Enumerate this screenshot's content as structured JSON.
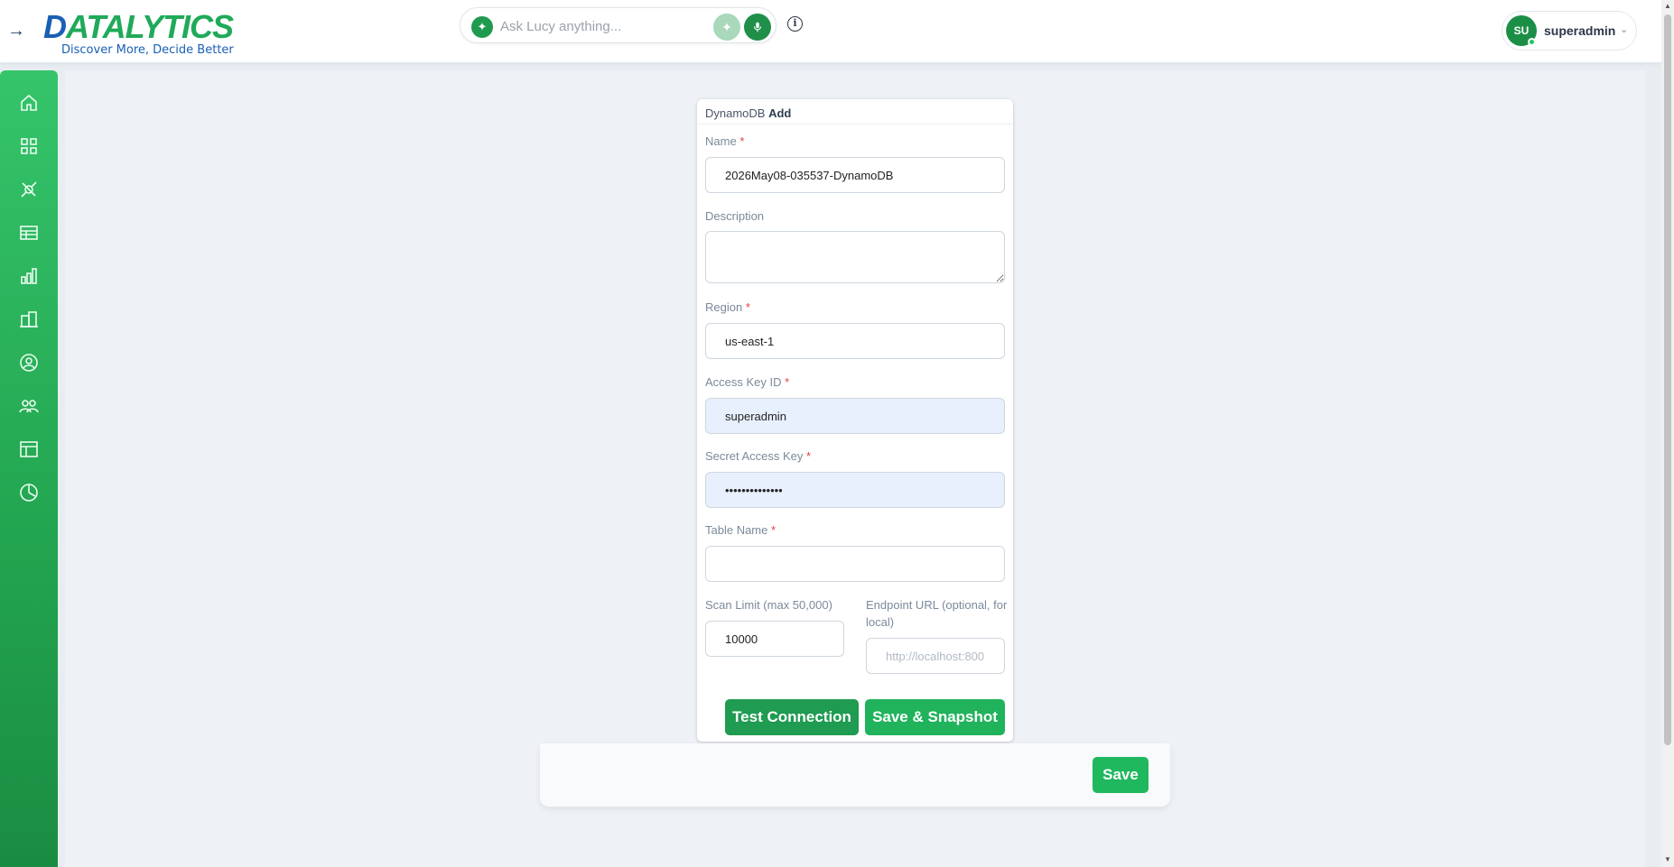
{
  "header": {
    "logo_text": "DATALYTICS",
    "logo_tagline": "Discover More, Decide Better",
    "search_placeholder": "Ask Lucy anything...",
    "user_initials": "SU",
    "user_name": "superadmin"
  },
  "sidebar": {
    "items": [
      {
        "icon": "home-icon"
      },
      {
        "icon": "dashboard-grid-icon"
      },
      {
        "icon": "connection-plug-icon"
      },
      {
        "icon": "table-icon"
      },
      {
        "icon": "bar-chart-icon"
      },
      {
        "icon": "building-icon"
      },
      {
        "icon": "user-circle-icon"
      },
      {
        "icon": "users-group-icon"
      },
      {
        "icon": "layout-icon"
      },
      {
        "icon": "pie-clock-icon"
      }
    ]
  },
  "form": {
    "title_prefix": "DynamoDB",
    "title_action": "Add",
    "name_label": "Name",
    "name_value": "2026May08-035537-DynamoDB",
    "description_label": "Description",
    "description_value": "",
    "region_label": "Region",
    "region_value": "us-east-1",
    "access_key_label": "Access Key ID",
    "access_key_value": "superadmin",
    "secret_key_label": "Secret Access Key",
    "secret_key_value": "••••••••••••••",
    "table_name_label": "Table Name",
    "table_name_value": "",
    "scan_limit_label": "Scan Limit (max 50,000)",
    "scan_limit_value": "10000",
    "endpoint_label": "Endpoint URL (optional, for local)",
    "endpoint_placeholder": "http://localhost:800",
    "required_mark": "*",
    "test_button": "Test Connection",
    "snapshot_button": "Save & Snapshot"
  },
  "savebar": {
    "save_button": "Save"
  },
  "colors": {
    "brand_green": "#1faa59",
    "brand_blue": "#1a5fb4",
    "button_green": "#1f9b52"
  }
}
